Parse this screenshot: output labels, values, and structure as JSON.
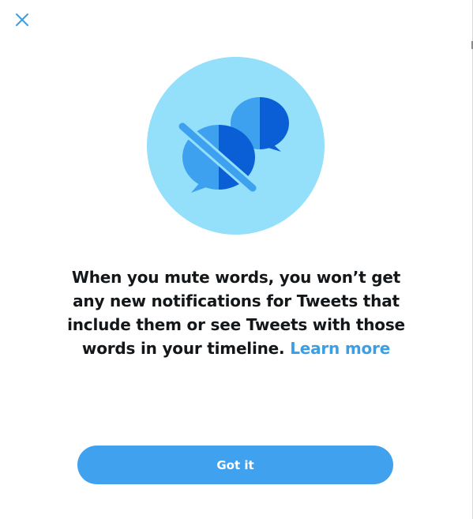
{
  "dialog": {
    "close_icon": "close-icon",
    "illustration_icon": "muted-chat-bubbles-icon",
    "message_text": "When you mute words, you won’t get any new notifications for Tweets that include them or see Tweets with those words in your timeline.",
    "learn_more_label": "Learn more",
    "got_it_label": "Got it"
  },
  "colors": {
    "accent": "#40a2ef",
    "link": "#3a9fe6",
    "illustration_bg": "#94dffa",
    "bubble_dark": "#0a5fd6",
    "bubble_light": "#3ea1ef",
    "text": "#14171a"
  }
}
